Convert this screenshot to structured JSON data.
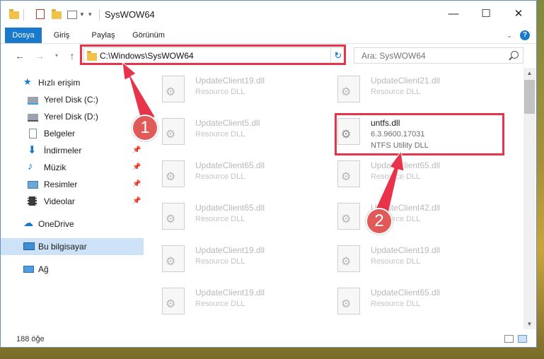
{
  "window": {
    "title": "SysWOW64",
    "controls": {
      "minimize": "—",
      "maximize": "☐",
      "close": "✕"
    }
  },
  "ribbon": {
    "tabs": [
      "Dosya",
      "Giriş",
      "Paylaş",
      "Görünüm"
    ],
    "help_label": "?"
  },
  "address": {
    "path": "C:\\Windows\\SysWOW64",
    "search_placeholder": "Ara: SysWOW64"
  },
  "sidebar": {
    "quick_access": "Hızlı erişim",
    "items": [
      {
        "label": "Yerel Disk (C:)",
        "icon": "drive-icon"
      },
      {
        "label": "Yerel Disk (D:)",
        "icon": "drive-icon"
      },
      {
        "label": "Belgeler",
        "icon": "documents-icon"
      },
      {
        "label": "İndirmeler",
        "icon": "downloads-icon"
      },
      {
        "label": "Müzik",
        "icon": "music-icon"
      },
      {
        "label": "Resimler",
        "icon": "pictures-icon"
      },
      {
        "label": "Videolar",
        "icon": "videos-icon"
      }
    ],
    "onedrive": "OneDrive",
    "this_pc": "Bu bilgisayar",
    "network": "Ağ",
    "pin_glyph": "📌"
  },
  "files": [
    {
      "name": "UpdateClient19.dll",
      "desc": "Resource DLL"
    },
    {
      "name": "UpdateClient21.dll",
      "desc": "Resource DLL"
    },
    {
      "name": "UpdateClient5.dll",
      "desc": "Resource DLL"
    },
    {
      "name": "untfs.dll",
      "version": "6.3.9600.17031",
      "desc": "NTFS Utility DLL",
      "highlighted": true
    },
    {
      "name": "UpdateClient65.dll",
      "desc": "Resource DLL"
    },
    {
      "name": "UpdateClient65.dll",
      "desc": "Resource DLL"
    },
    {
      "name": "UpdateClient65.dll",
      "desc": "Resource DLL"
    },
    {
      "name": "UpdateClient42.dll",
      "desc": "Resource DLL"
    },
    {
      "name": "UpdateClient19.dll",
      "desc": "Resource DLL"
    },
    {
      "name": "UpdateClient19.dll",
      "desc": "Resource DLL"
    },
    {
      "name": "UpdateClient19.dll",
      "desc": "Resource DLL"
    },
    {
      "name": "UpdateClient65.dll",
      "desc": "Resource DLL"
    }
  ],
  "status": {
    "count": "188 öğe"
  },
  "annotations": {
    "callout1": "1",
    "callout2": "2",
    "color": "#e8334a"
  }
}
